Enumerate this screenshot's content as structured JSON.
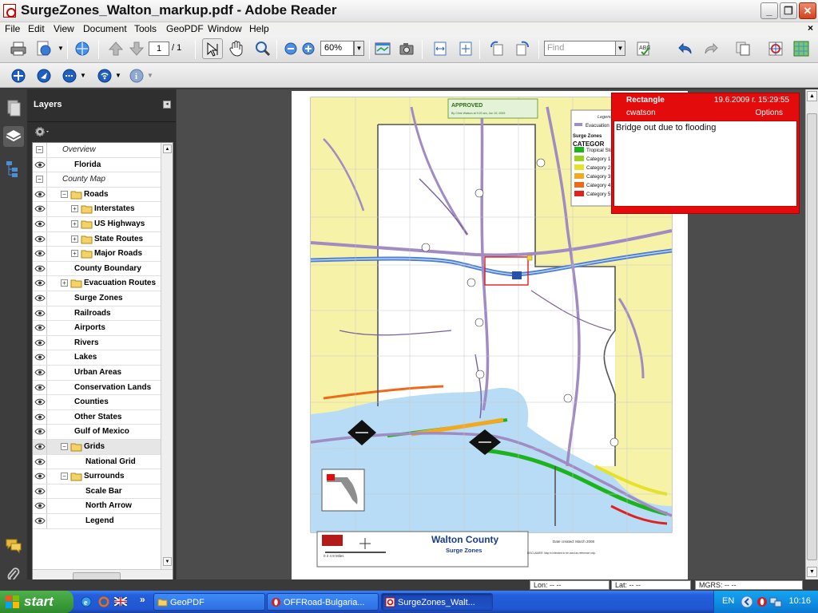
{
  "window": {
    "title": "SurgeZones_Walton_markup.pdf - Adobe Reader",
    "min_label": "_",
    "max_label": "❐",
    "close_label": "✕"
  },
  "menu": {
    "items": [
      "File",
      "Edit",
      "View",
      "Document",
      "Tools",
      "GeoPDF",
      "Window",
      "Help"
    ],
    "doc_close": "×"
  },
  "toolbar": {
    "page_current": "1",
    "page_total": "/ 1",
    "zoom": "60%",
    "find_placeholder": "Find"
  },
  "layers_panel": {
    "title": "Layers",
    "items": [
      {
        "label": "Overview",
        "style": "group"
      },
      {
        "label": "Florida",
        "style": "layer"
      },
      {
        "label": "County Map",
        "style": "group"
      },
      {
        "label": "Roads",
        "style": "folder",
        "expander": "−"
      },
      {
        "label": "Interstates",
        "style": "folder",
        "expander": "+"
      },
      {
        "label": "US Highways",
        "style": "folder",
        "expander": "+"
      },
      {
        "label": "State Routes",
        "style": "folder",
        "expander": "+"
      },
      {
        "label": "Major Roads",
        "style": "folder",
        "expander": "+"
      },
      {
        "label": "County Boundary",
        "style": "layer"
      },
      {
        "label": "Evacuation Routes",
        "style": "folder",
        "expander": "+"
      },
      {
        "label": "Surge Zones",
        "style": "layer"
      },
      {
        "label": "Railroads",
        "style": "layer"
      },
      {
        "label": "Airports",
        "style": "layer"
      },
      {
        "label": "Rivers",
        "style": "layer"
      },
      {
        "label": "Lakes",
        "style": "layer"
      },
      {
        "label": "Urban Areas",
        "style": "layer"
      },
      {
        "label": "Conservation Lands",
        "style": "layer"
      },
      {
        "label": "Counties",
        "style": "layer"
      },
      {
        "label": "Other States",
        "style": "layer"
      },
      {
        "label": "Gulf of Mexico",
        "style": "layer"
      },
      {
        "label": "Grids",
        "style": "folder",
        "expander": "−"
      },
      {
        "label": "National Grid",
        "style": "sublayer"
      },
      {
        "label": "Surrounds",
        "style": "folder",
        "expander": "−"
      },
      {
        "label": "Scale Bar",
        "style": "sublayer"
      },
      {
        "label": "North Arrow",
        "style": "sublayer"
      },
      {
        "label": "Legend",
        "style": "sublayer"
      }
    ]
  },
  "map": {
    "approved_stamp": "APPROVED",
    "approved_sub": "By Chris Watson at 9:20 am, Jun 19, 2009",
    "legend_title": "Legend",
    "legend_evac": "Evacuation",
    "legend_surge": "Surge Zones",
    "legend_category": "CATEGOR",
    "legend_items": [
      {
        "label": "Tropical Storm",
        "color": "#1db31d"
      },
      {
        "label": "Category 1",
        "color": "#9ad11c"
      },
      {
        "label": "Category 2",
        "color": "#e6e12a"
      },
      {
        "label": "Category 3",
        "color": "#f2a91e"
      },
      {
        "label": "Category 4",
        "color": "#ee6a19"
      },
      {
        "label": "Category 5",
        "color": "#e0211c"
      }
    ],
    "county_title": "Walton County",
    "county_sub": "Surge Zones",
    "date_created": "Date created: March 2008",
    "disclaimer": "DISCLAIMER: Map is intended to be used as reference only.",
    "scale_label": "0    2    4         8 Miles"
  },
  "comment": {
    "type": "Rectangle",
    "date": "19.6.2009 г. 15:29:55",
    "author": "cwatson",
    "options": "Options",
    "body": "Bridge out due to flooding"
  },
  "statusbar": {
    "lon": "Lon: -- --",
    "lat": "Lat: -- --",
    "mgrs": "MGRS: -- --"
  },
  "taskbar": {
    "start": "start",
    "tasks": [
      "GeoPDF",
      "OFFRoad-Bulgaria...",
      "SurgeZones_Walt..."
    ],
    "lang": "EN",
    "clock": "10:16"
  },
  "colors": {
    "comment": "#e30b0b",
    "gulf": "#b8dcf5",
    "land_yellow": "#f6f3a8",
    "land_white": "#ffffff",
    "road_purple": "#a08bc2",
    "interstate_blue": "#4b7ed6"
  }
}
